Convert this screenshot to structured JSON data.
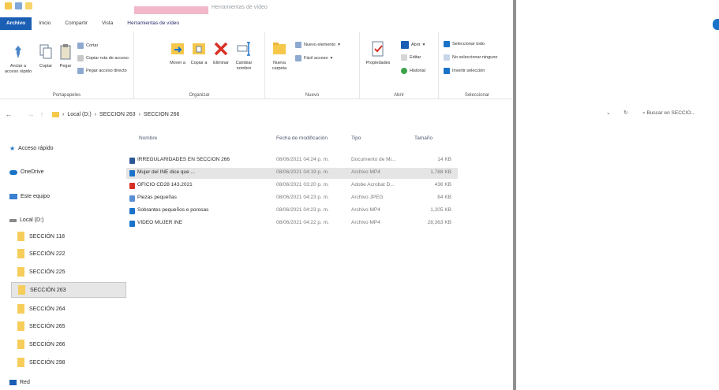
{
  "window": {
    "title": "Herramientas de vídeo",
    "accent": "#1a5fb4"
  },
  "tabs": [
    {
      "label": "Archivo"
    },
    {
      "label": "Inicio"
    },
    {
      "label": "Compartir"
    },
    {
      "label": "Vista"
    },
    {
      "label": "Herramientas de vídeo"
    }
  ],
  "ribbon": {
    "portapapeles": {
      "label": "Portapapeles",
      "pin": "Anclar a acceso rápido",
      "copy": "Copiar",
      "paste": "Pegar",
      "cut": "Cortar",
      "copy_path": "Copiar ruta de acceso",
      "paste_shortcut": "Pegar acceso directo"
    },
    "organizar": {
      "label": "Organizar",
      "move": "Mover a",
      "copy_to": "Copiar a",
      "delete": "Eliminar",
      "rename": "Cambiar nombre"
    },
    "nuevo": {
      "label": "Nuevo",
      "new_folder": "Nueva carpeta",
      "new_item": "Nuevo elemento",
      "easy_access": "Fácil acceso"
    },
    "abrir": {
      "label": "Abrir",
      "properties": "Propiedades",
      "open": "Abrir",
      "edit": "Editar",
      "history": "Historial"
    },
    "seleccionar": {
      "label": "Seleccionar",
      "select_all": "Seleccionar todo",
      "select_none": "No seleccionar ninguno",
      "invert": "Invertir selección"
    }
  },
  "address": {
    "crumbs": [
      "Local (D:)",
      "SECCION 263",
      "SECCION 266"
    ],
    "search_placeholder": "Buscar en SECCIO..."
  },
  "sidebar": {
    "quick_access": "Acceso rápido",
    "onedrive": "OneDrive",
    "this_pc": "Este equipo",
    "local_disk": "Local (D:)",
    "network": "Red",
    "folders": [
      {
        "label": "SECCIÓN 118"
      },
      {
        "label": "SECCIÓN 222"
      },
      {
        "label": "SECCIÓN 225"
      },
      {
        "label": "SECCIÓN 263"
      },
      {
        "label": "SECCIÓN 264"
      },
      {
        "label": "SECCIÓN 265"
      },
      {
        "label": "SECCIÓN 266"
      },
      {
        "label": "SECCIÓN 298"
      }
    ]
  },
  "columns": {
    "name": "Nombre",
    "date": "Fecha de modificación",
    "type": "Tipo",
    "size": "Tamaño"
  },
  "files": [
    {
      "name": "IRREGULARIDADES EN SECCIÓN 266",
      "date": "08/06/2021 04:24 p. m.",
      "type": "Documento de Mi...",
      "size": "14 KB",
      "icon": "word-doc-icon",
      "color": "#2b5797"
    },
    {
      "name": "Mujer del INE dice que ...",
      "date": "08/06/2021 04:19 p. m.",
      "type": "Archivo MP4",
      "size": "1,788 KB",
      "icon": "video-file-icon",
      "color": "#1a73c8"
    },
    {
      "name": "OFICIO CD28 143.2021",
      "date": "08/06/2021 03:20 p. m.",
      "type": "Adobe Acrobat D...",
      "size": "436 KB",
      "icon": "pdf-file-icon",
      "color": "#d93025"
    },
    {
      "name": "Piezas pequeñas",
      "date": "08/06/2021 04:23 p. m.",
      "type": "Archivo JPEG",
      "size": "84 KB",
      "icon": "image-file-icon",
      "color": "#5a8fd6"
    },
    {
      "name": "Sobrantes pequeños e porosas",
      "date": "08/06/2021 04:23 p. m.",
      "type": "Archivo MP4",
      "size": "1,205 KB",
      "icon": "video-file-icon",
      "color": "#1a73c8"
    },
    {
      "name": "VIDEO MUJER INE",
      "date": "08/06/2021 04:22 p. m.",
      "type": "Archivo MP4",
      "size": "28,363 KB",
      "icon": "video-file-icon",
      "color": "#1a73c8"
    }
  ]
}
